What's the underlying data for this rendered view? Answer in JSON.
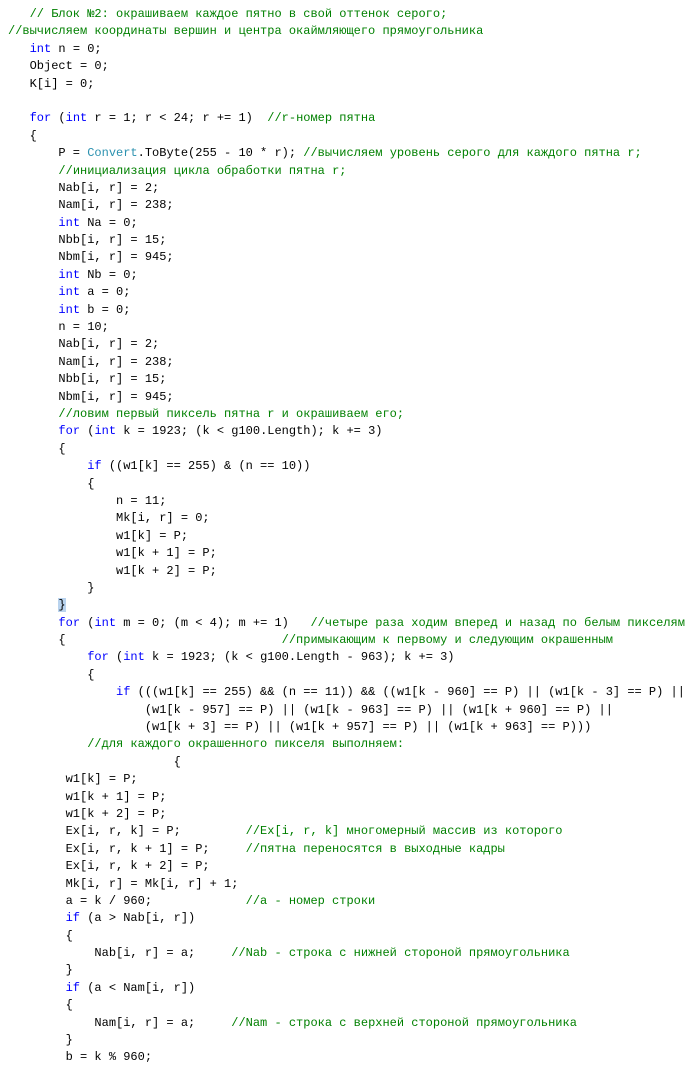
{
  "code": {
    "l1": "   // Блок №2: окрашиваем каждое пятно в свой оттенок серого;",
    "l2": "//вычисляем координаты вершин и центра окаймляющего прямоугольника",
    "l3a": "int",
    "l3b": " n = 0;",
    "l4": "   Object = 0;",
    "l5": "   K[i] = 0;",
    "blank1": "",
    "l6a": "for",
    "l6b": " (",
    "l6c": "int",
    "l6d": " r = 1; r < 24; r += 1)  ",
    "l6e": "//r-номер пятна",
    "l7": "   {",
    "l8a": "       P = ",
    "l8b": "Convert",
    "l8c": ".ToByte(255 - 10 * r); ",
    "l8d": "//вычисляем уровень серого для каждого пятна r;",
    "l9": "//инициализация цикла обработки пятна r;",
    "l10": "       Nab[i, r] = 2;",
    "l11": "       Nam[i, r] = 238;",
    "l12a": "int",
    "l12b": " Na = 0;",
    "l13": "       Nbb[i, r] = 15;",
    "l14": "       Nbm[i, r] = 945;",
    "l15a": "int",
    "l15b": " Nb = 0;",
    "l16a": "int",
    "l16b": " a = 0;",
    "l17a": "int",
    "l17b": " b = 0;",
    "l18": "       n = 10;",
    "l19": "       Nab[i, r] = 2;",
    "l20": "       Nam[i, r] = 238;",
    "l21": "       Nbb[i, r] = 15;",
    "l22": "       Nbm[i, r] = 945;",
    "l23": "//ловим первый пиксель пятна r и окрашиваем его;",
    "l24a": "for",
    "l24b": " (",
    "l24c": "int",
    "l24d": " k = 1923; (k < g100.Length); k += 3)",
    "l25": "       {",
    "l26a": "if",
    "l26b": " ((w1[k] == 255) & (n == 10))",
    "l27": "           {",
    "l28": "               n = 11;",
    "l29": "               Mk[i, r] = 0;",
    "l30": "               w1[k] = P;",
    "l31": "               w1[k + 1] = P;",
    "l32": "               w1[k + 2] = P;",
    "l33": "           }",
    "l34": "}",
    "l35a": "for",
    "l35b": " (",
    "l35c": "int",
    "l35d": " m = 0; (m < 4); m += 1)   ",
    "l35e": "//четыре раза ходим вперед и назад по белым пикселям,",
    "l36a": "       {                              ",
    "l36b": "//примыкающим к первому и следующим окрашенным",
    "l37a": "for",
    "l37b": " (",
    "l37c": "int",
    "l37d": " k = 1923; (k < g100.Length - 963); k += 3)",
    "l38": "           {",
    "l39a": "if",
    "l39b": " (((w1[k] == 255) && (n == 11)) && ((w1[k - 960] == P) || (w1[k - 3] == P) ||",
    "l40": "                   (w1[k - 957] == P) || (w1[k - 963] == P) || (w1[k + 960] == P) ||",
    "l41": "                   (w1[k + 3] == P) || (w1[k + 957] == P) || (w1[k + 963] == P)))",
    "l42": "//для каждого окрашенного пикселя выполняем:",
    "l43": "                       {",
    "l44": "        w1[k] = P;",
    "l45": "        w1[k + 1] = P;",
    "l46": "        w1[k + 2] = P;",
    "l47a": "        Ex[i, r, k] = P;         ",
    "l47b": "//Ex[i, r, k] многомерный массив из которого",
    "l48a": "        Ex[i, r, k + 1] = P;     ",
    "l48b": "//пятна переносятся в выходные кадры",
    "l49": "        Ex[i, r, k + 2] = P;",
    "l50": "        Mk[i, r] = Mk[i, r] + 1;",
    "l51a": "        a = k / 960;             ",
    "l51b": "//a - номер строки",
    "l52a": "if",
    "l52b": " (a > Nab[i, r])",
    "l53": "        {",
    "l54a": "            Nab[i, r] = a;     ",
    "l54b": "//Nab - строка с нижней стороной прямоугольника",
    "l55": "        }",
    "l56a": "if",
    "l56b": " (a < Nam[i, r])",
    "l57": "        {",
    "l58a": "            Nam[i, r] = a;     ",
    "l58b": "//Nam - строка с верхней стороной прямоугольника",
    "l59": "        }",
    "l60": "        b = k % 960;"
  }
}
